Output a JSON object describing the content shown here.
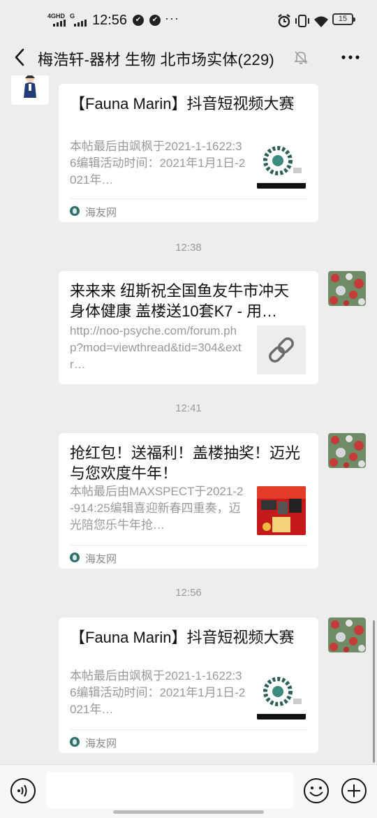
{
  "status_bar": {
    "network_1": "4GHD",
    "network_2": "G",
    "time": "12:56",
    "more": "···",
    "battery": "15"
  },
  "header": {
    "title": "梅浩轩-器材 生物 北市场实体(229)",
    "back_icon": "chevron-left-icon",
    "mute_icon": "bell-off-icon",
    "menu_icon": "more-dots-icon"
  },
  "messages": [
    {
      "title": "【Fauna Marin】抖音短视频大赛",
      "desc": "本帖最后由飒枫于2021-1-1622:36编辑活动时间：2021年1月1日-2021年…",
      "source": "海友网",
      "thumb": "qr-code"
    },
    {
      "timestamp": "12:38",
      "title": "来来来 纽斯祝全国鱼友牛市冲天 身体健康 盖楼送10套K7 - 用…",
      "desc": "http://noo-psyche.com/forum.php?mod=viewthread&tid=304&extr…",
      "thumb": "link-icon"
    },
    {
      "timestamp": "12:41",
      "title": "抢红包！送福利！盖楼抽奖！迈光与您欢度牛年！",
      "desc": "本帖最后由MAXSPECT于2021-2-914:25编辑喜迎新春四重奏，迈光陪您乐牛年抢…",
      "source": "海友网",
      "thumb": "red-poster"
    },
    {
      "timestamp": "12:56",
      "title": "【Fauna Marin】抖音短视频大赛",
      "desc": "本帖最后由飒枫于2021-1-1622:36编辑活动时间：2021年1月1日-2021年…",
      "source": "海友网",
      "thumb": "qr-code"
    }
  ],
  "input": {
    "placeholder": "",
    "voice_icon": "voice-icon",
    "emoji_icon": "emoji-icon",
    "plus_icon": "plus-icon"
  }
}
